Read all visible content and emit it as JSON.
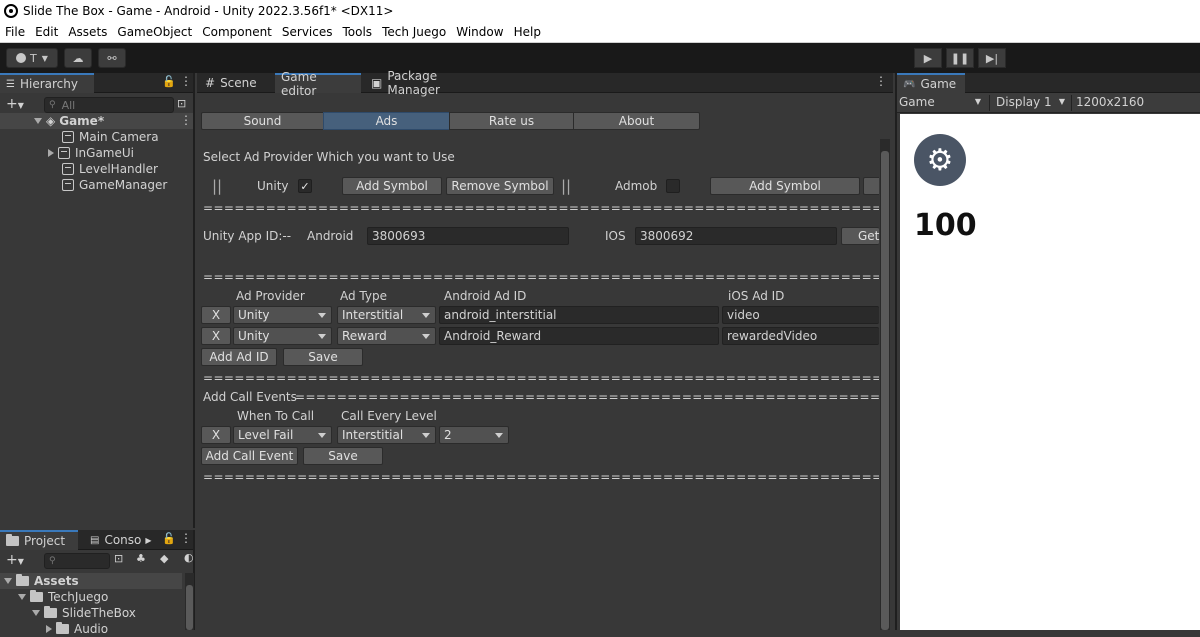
{
  "window": {
    "title": "Slide The Box - Game - Android - Unity 2022.3.56f1* <DX11>"
  },
  "menu": [
    "File",
    "Edit",
    "Assets",
    "GameObject",
    "Component",
    "Services",
    "Tools",
    "Tech Juego",
    "Window",
    "Help"
  ],
  "toolbar": {
    "account": "T"
  },
  "hierarchy": {
    "tab": "Hierarchy",
    "search_placeholder": "All",
    "scene": "Game*",
    "items": [
      "Main Camera",
      "InGameUi",
      "LevelHandler",
      "GameManager"
    ]
  },
  "project": {
    "tabs": [
      "Project",
      "Conso"
    ],
    "root": "Assets",
    "folders": [
      "TechJuego",
      "SlideTheBox",
      "Audio"
    ]
  },
  "editor_tabs": [
    "Scene",
    "Game editor",
    "Package Manager"
  ],
  "game_view": {
    "tab": "Game",
    "mode": "Game",
    "display": "Display 1",
    "resolution": "1200x2160",
    "score": "100"
  },
  "game_editor": {
    "subtabs": [
      "Sound",
      "Ads",
      "Rate us",
      "About"
    ],
    "active_subtab": "Ads",
    "select_provider_label": "Select Ad Provider Which you want to Use",
    "unity_label": "Unity",
    "unity_checked": "✓",
    "add_symbol": "Add  Symbol",
    "remove_symbol": "Remove Symbol",
    "admob_label": "Admob",
    "admob_add_symbol": "Add  Symbol",
    "separator": "================================================================================================",
    "unity_app_id_label": "Unity App ID:--",
    "android_label": "Android",
    "android_id": "3800693",
    "ios_label": "IOS",
    "ios_id": "3800692",
    "get_label": "Get",
    "ad_headers": {
      "provider": "Ad Provider",
      "type": "Ad Type",
      "android": "Android Ad ID",
      "ios": "iOS Ad ID"
    },
    "ad_rows": [
      {
        "remove": "X",
        "provider": "Unity",
        "type": "Interstitial",
        "android": "android_interstitial",
        "ios": "video"
      },
      {
        "remove": "X",
        "provider": "Unity",
        "type": "Reward",
        "android": "Android_Reward",
        "ios": "rewardedVideo"
      }
    ],
    "add_ad_id": "Add Ad ID",
    "save": "Save",
    "call_events_label": "Add Call Events",
    "call_headers": {
      "when": "When To Call",
      "every": "Call Every Level"
    },
    "call_rows": [
      {
        "remove": "X",
        "when": "Level Fail",
        "type": "Interstitial",
        "level": "2"
      }
    ],
    "add_call_event": "Add Call Event",
    "save2": "Save"
  }
}
